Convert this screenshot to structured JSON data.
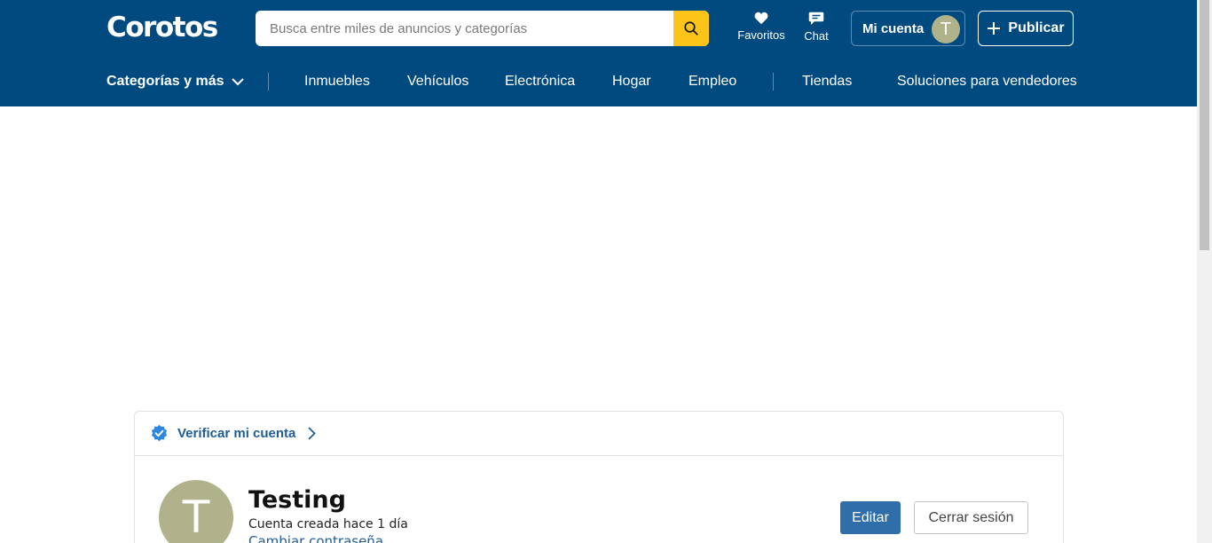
{
  "header": {
    "logo": "Corotos",
    "search": {
      "placeholder": "Busca entre miles de anuncios y categorías",
      "value": ""
    },
    "favorites_label": "Favoritos",
    "chat_label": "Chat",
    "account_label": "Mi cuenta",
    "avatar_initial": "T",
    "publish_label": "Publicar"
  },
  "nav": {
    "categories_label": "Categorías y más",
    "items": [
      "Inmuebles",
      "Vehículos",
      "Electrónica",
      "Hogar",
      "Empleo",
      "Tiendas",
      "Soluciones para vendedores"
    ]
  },
  "profile": {
    "verify_label": "Verificar mi cuenta",
    "avatar_initial": "T",
    "name": "Testing",
    "created": "Cuenta creada hace 1 día",
    "change_password": "Cambiar contraseña",
    "edit_label": "Editar",
    "logout_label": "Cerrar sesión"
  },
  "colors": {
    "header_bg": "#004a80",
    "search_button": "#fcc419",
    "avatar_bg": "#b0b28b",
    "link": "#1f5d96",
    "primary_button": "#2f6ea8"
  }
}
